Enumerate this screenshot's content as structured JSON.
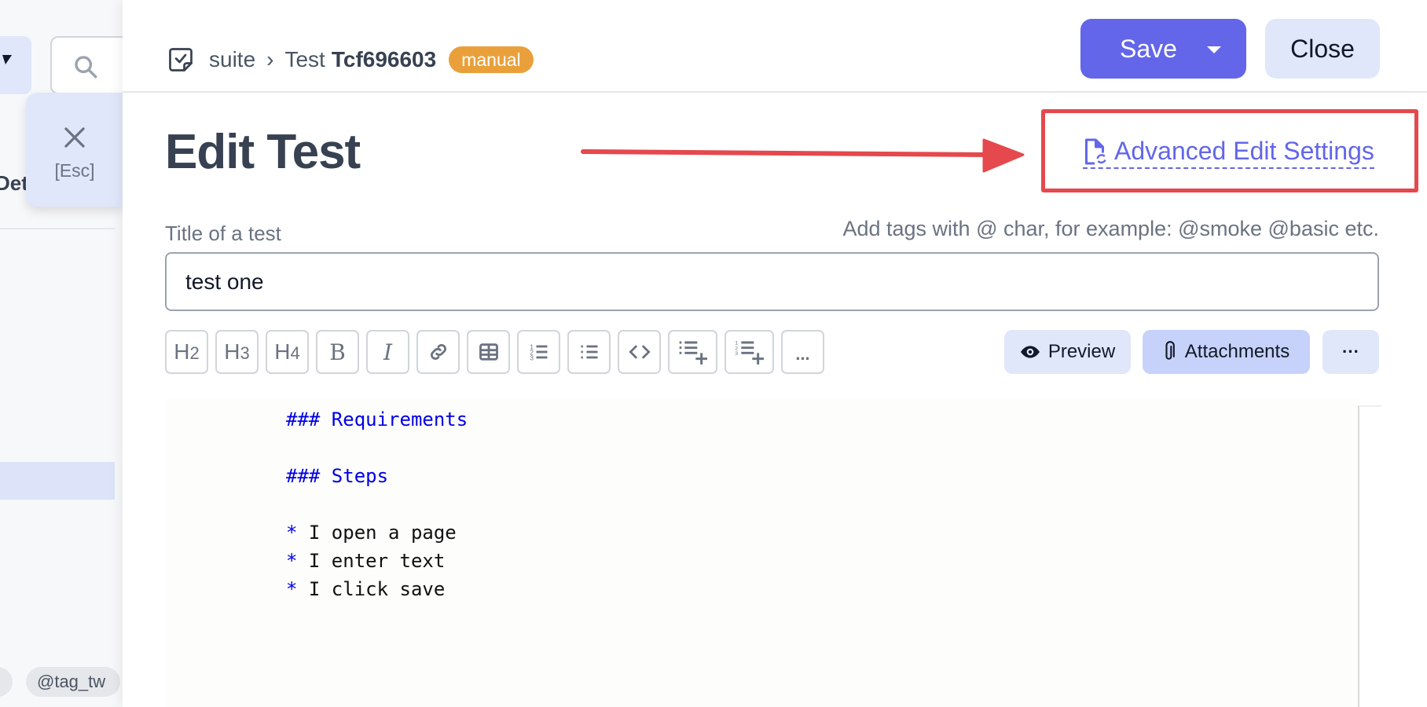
{
  "left_panel": {
    "partial_heading": "Deta",
    "tags": [
      "",
      "@tag_tw"
    ],
    "search_icon": "search-icon",
    "dropdown_icon": "caret-down-icon"
  },
  "esc_button": {
    "icon": "close-icon",
    "label": "[Esc]"
  },
  "header": {
    "breadcrumb": {
      "icon": "test-file-check-icon",
      "suite": "suite",
      "separator": "›",
      "test_prefix": "Test",
      "test_id": "Tcf696603",
      "badge": "manual"
    },
    "save_label": "Save",
    "close_label": "Close"
  },
  "page": {
    "title": "Edit Test",
    "advanced_link": "Advanced Edit Settings"
  },
  "form": {
    "title_label": "Title of a test",
    "tags_hint": "Add tags with @ char, for example: @smoke @basic etc.",
    "title_value": "test one"
  },
  "toolbar": {
    "buttons": [
      {
        "name": "heading-2",
        "label": "H2"
      },
      {
        "name": "heading-3",
        "label": "H3"
      },
      {
        "name": "heading-4",
        "label": "H4"
      },
      {
        "name": "bold",
        "label": "B"
      },
      {
        "name": "italic",
        "label": "I"
      },
      {
        "name": "link",
        "label": ""
      },
      {
        "name": "table",
        "label": ""
      },
      {
        "name": "ordered-list",
        "label": ""
      },
      {
        "name": "unordered-list",
        "label": ""
      },
      {
        "name": "code",
        "label": ""
      },
      {
        "name": "add-step-list",
        "label": ""
      },
      {
        "name": "add-ordered-step-list",
        "label": ""
      },
      {
        "name": "more-formatting",
        "label": "..."
      }
    ],
    "preview_label": "Preview",
    "attachments_label": "Attachments",
    "more_label": "···"
  },
  "editor": {
    "lines": [
      {
        "type": "heading",
        "marker": "###",
        "text": "Requirements"
      },
      {
        "type": "blank",
        "text": ""
      },
      {
        "type": "heading",
        "marker": "###",
        "text": "Steps"
      },
      {
        "type": "blank",
        "text": ""
      },
      {
        "type": "bullet",
        "marker": "*",
        "text": "I open a page"
      },
      {
        "type": "bullet",
        "marker": "*",
        "text": "I enter text"
      },
      {
        "type": "bullet",
        "marker": "*",
        "text": "I click save"
      }
    ]
  },
  "colors": {
    "accent": "#6366e8",
    "badge_manual": "#eaa03a",
    "annotation_red": "#e5484d",
    "markdown_blue": "#0000e6"
  }
}
